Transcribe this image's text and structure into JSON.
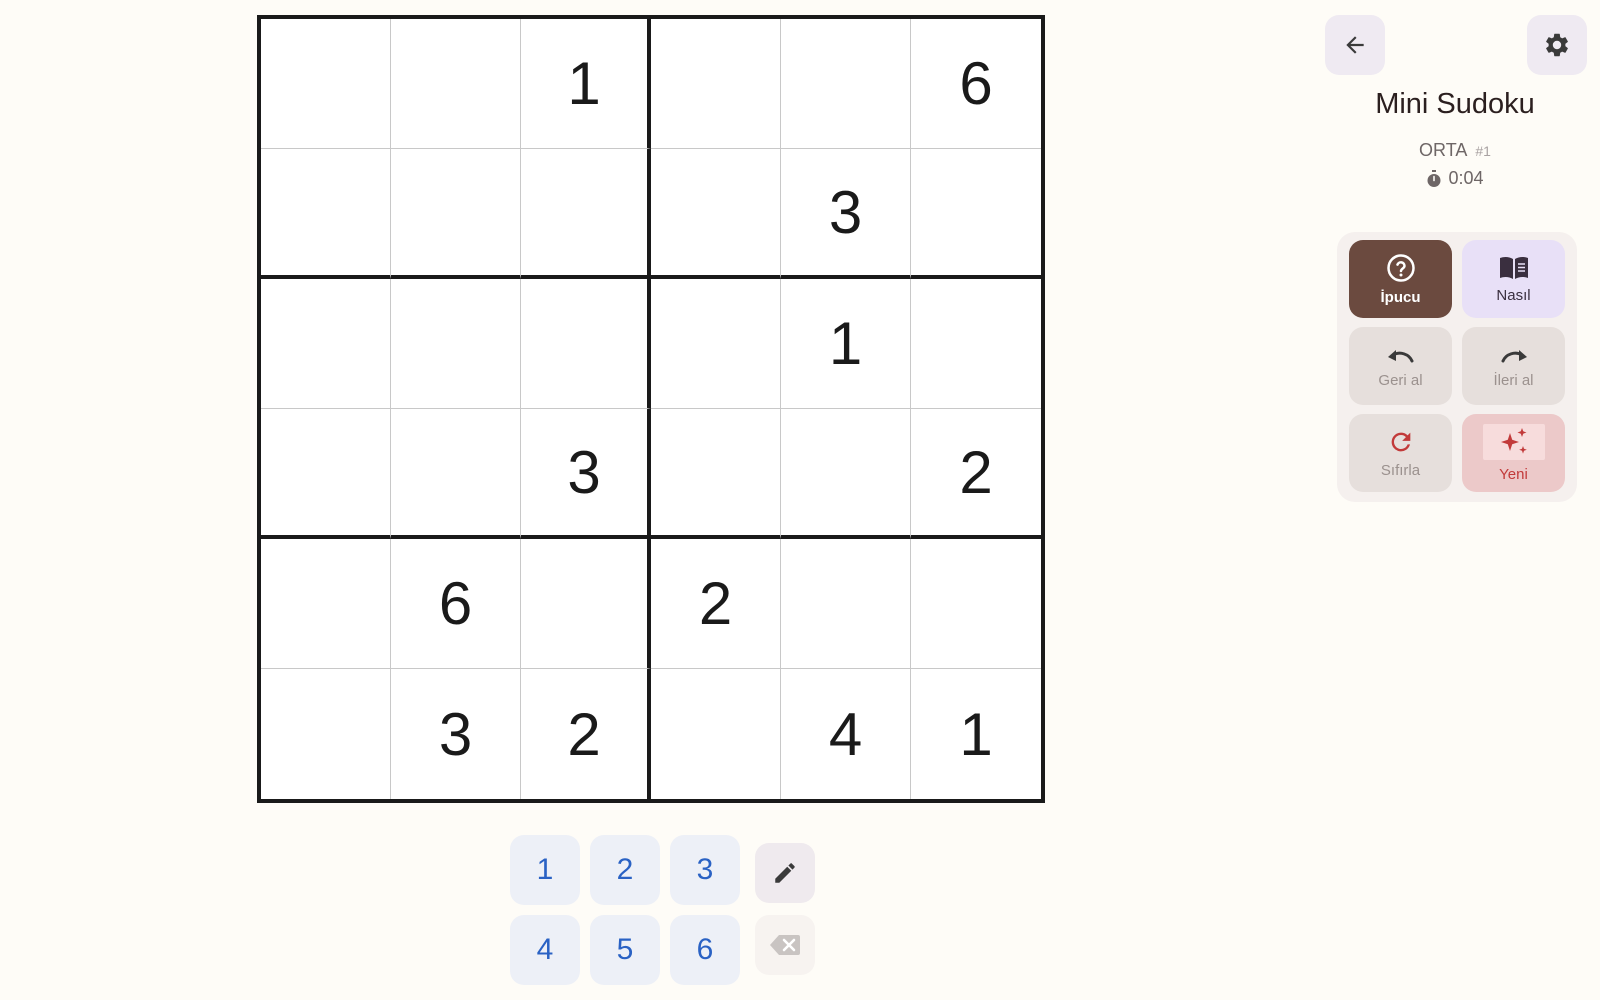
{
  "board": {
    "cells": [
      [
        "",
        "",
        "1",
        "",
        "",
        "6"
      ],
      [
        "",
        "",
        "",
        "",
        "3",
        ""
      ],
      [
        "",
        "",
        "",
        "",
        "1",
        ""
      ],
      [
        "",
        "",
        "3",
        "",
        "",
        "2"
      ],
      [
        "",
        "6",
        "",
        "2",
        "",
        ""
      ],
      [
        "",
        "3",
        "2",
        "",
        "4",
        "1"
      ]
    ]
  },
  "numpad": {
    "digits": [
      "1",
      "2",
      "3",
      "4",
      "5",
      "6"
    ]
  },
  "header": {
    "back_icon": "arrow-left-icon",
    "settings_icon": "gear-icon"
  },
  "game": {
    "title": "Mini Sudoku",
    "difficulty": "ORTA",
    "puzzle_number": "#1",
    "timer": "0:04"
  },
  "actions": {
    "hint_label": "İpucu",
    "howto_label": "Nasıl",
    "undo_label": "Geri al",
    "redo_label": "İleri al",
    "reset_label": "Sıfırla",
    "new_label": "Yeni"
  },
  "colors": {
    "background": "#fefcf7",
    "hint_button": "#6b4a3f",
    "digit_blue": "#2a62c4",
    "new_red": "#c23a3a"
  }
}
